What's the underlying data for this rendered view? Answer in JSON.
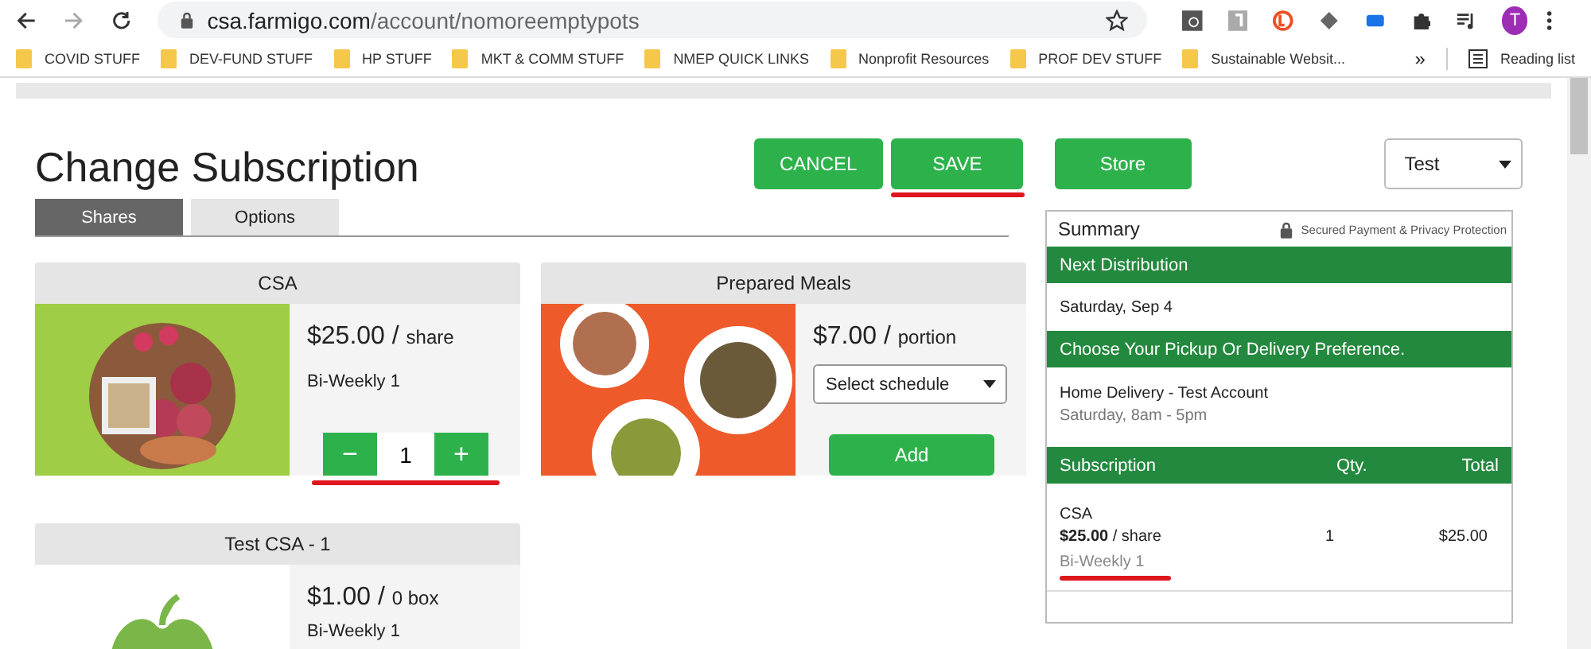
{
  "browser": {
    "url_host": "csa.farmigo.com",
    "url_path": "/account/nomoreemptypots",
    "profile_initial": "T",
    "bookmarks": [
      "COVID STUFF",
      "DEV-FUND STUFF",
      "HP STUFF",
      "MKT & COMM STUFF",
      "NMEP QUICK LINKS",
      "Nonprofit Resources",
      "PROF DEV STUFF",
      "Sustainable Websit..."
    ],
    "overflow": "»",
    "reading_list": "Reading list"
  },
  "page": {
    "title": "Change Subscription",
    "actions": [
      {
        "label": "CANCEL",
        "underlined": false
      },
      {
        "label": "SAVE",
        "underlined": true
      },
      {
        "label": "Store",
        "underlined": false
      }
    ],
    "store_select": {
      "value": "Test"
    },
    "tabs": [
      {
        "label": "Shares",
        "selected": true
      },
      {
        "label": "Options",
        "selected": false
      }
    ],
    "shares": [
      {
        "title": "CSA",
        "image": {
          "kind": "vegetables"
        },
        "kind": "stepper",
        "price": "$25.00 /",
        "unit": "share",
        "schedule": "Bi-Weekly 1",
        "minus": "−",
        "quantity": "1",
        "plus": "+",
        "underlined": true
      },
      {
        "title": "Prepared Meals",
        "image": {
          "kind": "meals"
        },
        "kind": "select",
        "price": "$7.00 /",
        "unit": "portion",
        "placeholder": "Select schedule",
        "add": "Add"
      },
      {
        "title": "Test CSA - 1",
        "image": {
          "kind": "apple"
        },
        "kind": "plain",
        "price": "$1.00 /",
        "unit": "0 box",
        "schedule": "Bi-Weekly 1"
      }
    ],
    "summary": {
      "title": "Summary",
      "secure": "Secured Payment & Privacy Protection",
      "next_heading": "Next Distribution",
      "next_date": "Saturday, Sep 4",
      "pickup_heading": "Choose Your Pickup Or Delivery Preference.",
      "delivery_name": "Home Delivery - Test Account",
      "delivery_time": "Saturday, 8am - 5pm",
      "columns": [
        "Subscription",
        "Qty.",
        "Total"
      ],
      "rows": [
        {
          "name": "CSA",
          "price": "**$25.00** / share",
          "schedule": "Bi-Weekly 1",
          "qty": "1",
          "total": "$25.00",
          "underlined": true
        }
      ]
    }
  }
}
